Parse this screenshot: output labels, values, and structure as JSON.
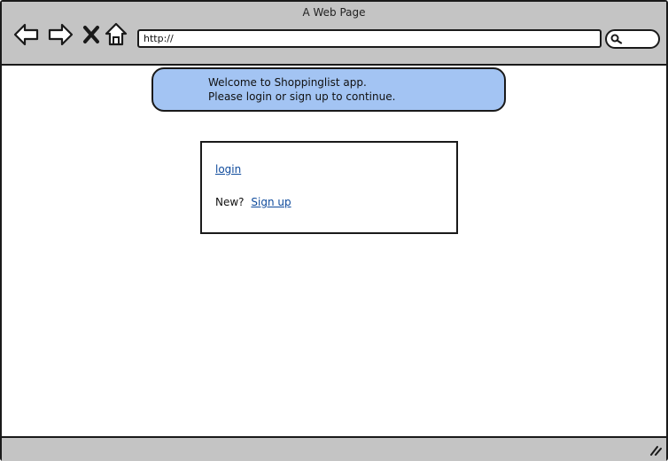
{
  "window": {
    "title": "A Web Page"
  },
  "toolbar": {
    "url": "http://",
    "icons": {
      "back": "back-arrow-icon",
      "forward": "forward-arrow-icon",
      "stop": "close-x-icon",
      "home": "home-icon",
      "search": "search-icon",
      "resize": "resize-grip-icon"
    }
  },
  "banner": {
    "line1": "Welcome to Shoppinglist app.",
    "line2": "Please login or sign up to continue."
  },
  "auth": {
    "login_label": "login",
    "new_prompt": "New?",
    "signup_label": "Sign up"
  },
  "colors": {
    "chrome": "#c4c4c4",
    "banner": "#a3c4f3",
    "link": "#0e4a9c",
    "border": "#1a1a1a"
  }
}
